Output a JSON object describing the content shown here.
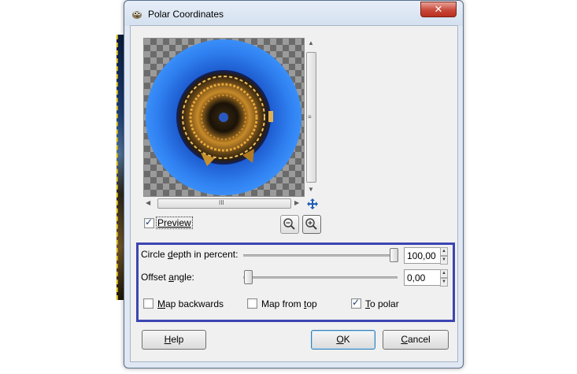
{
  "window": {
    "title": "Polar Coordinates",
    "close_symbol": "✕"
  },
  "preview": {
    "checkbox_label": "Preview",
    "checked": true
  },
  "options": {
    "circle_depth": {
      "label_pre": "Circle ",
      "label_u": "d",
      "label_post": "epth in percent:",
      "value": "100,00"
    },
    "offset_angle": {
      "label_pre": "Offset ",
      "label_u": "a",
      "label_post": "ngle:",
      "value": "0,00"
    },
    "map_backwards": {
      "label_pre": "",
      "label_u": "M",
      "label_post": "ap backwards",
      "checked": false
    },
    "map_from_top": {
      "label_pre": "Map from ",
      "label_u": "t",
      "label_post": "op",
      "checked": false
    },
    "to_polar": {
      "label_pre": "",
      "label_u": "T",
      "label_post": "o polar",
      "checked": true
    }
  },
  "buttons": {
    "help": {
      "label_u": "H",
      "label_post": "elp"
    },
    "ok": {
      "label_u": "O",
      "label_post": "K"
    },
    "cancel": {
      "label_u": "C",
      "label_post": "ancel"
    }
  },
  "scroll": {
    "grip_v": "≡",
    "grip_h": "III",
    "up": "▲",
    "down": "▼",
    "left": "◀",
    "right": "▶",
    "spin_up": "▲",
    "spin_down": "▼"
  }
}
